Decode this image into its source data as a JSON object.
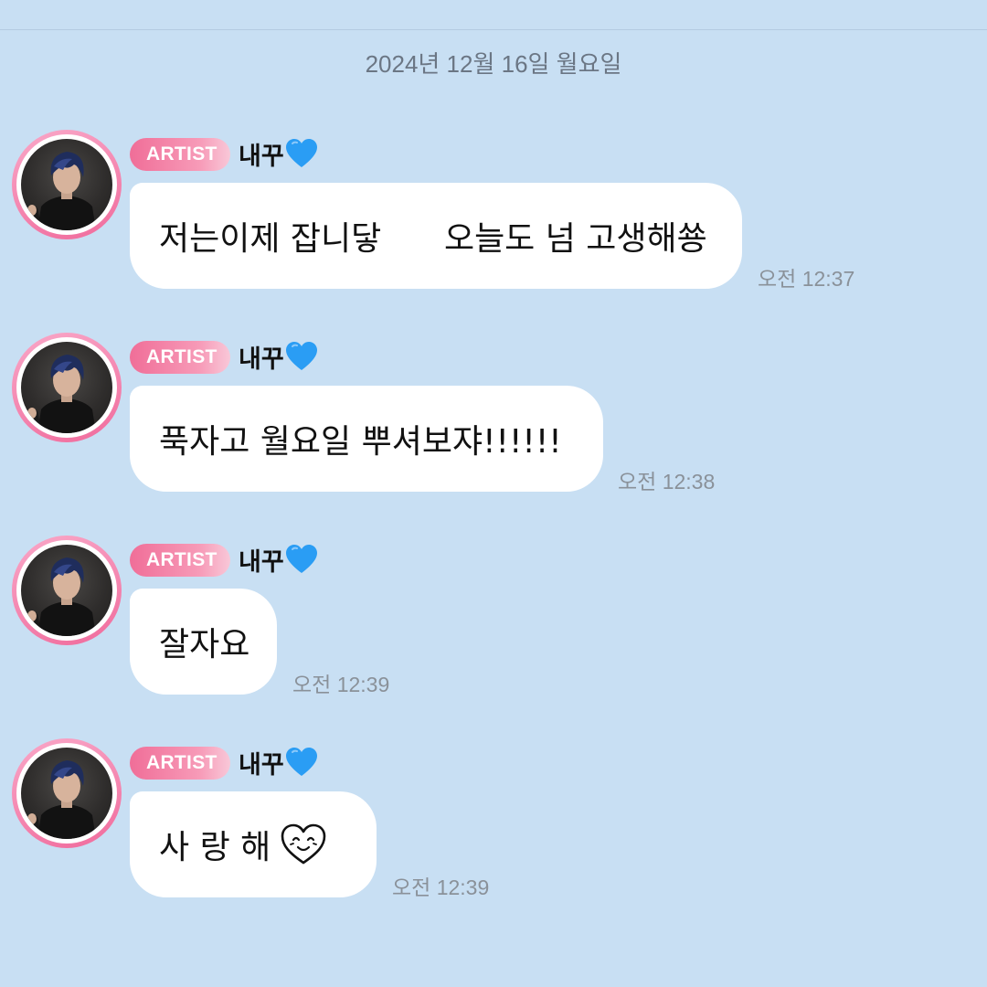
{
  "date_separator": "2024년 12월 16일 월요일",
  "messages": [
    {
      "badge": "ARTIST",
      "sender": "내꾸",
      "text": "저는이제 잡니닿      오늘도 넘 고생해쑝",
      "time": "오전 12:37"
    },
    {
      "badge": "ARTIST",
      "sender": "내꾸",
      "text": "푹자고 월요일 뿌셔보쟈!!!!!!",
      "time": "오전 12:38"
    },
    {
      "badge": "ARTIST",
      "sender": "내꾸",
      "text": "잘자요",
      "time": "오전 12:39"
    },
    {
      "badge": "ARTIST",
      "sender": "내꾸",
      "text": "사 랑 해",
      "time": "오전 12:39"
    }
  ],
  "colors": {
    "background": "#c8dff3",
    "badge_pink": "#f06e98",
    "heart_blue": "#2a9df4"
  },
  "icons": {
    "sender_heart": "blue-heart-icon",
    "message_heart": "smiling-heart-doodle-icon"
  }
}
